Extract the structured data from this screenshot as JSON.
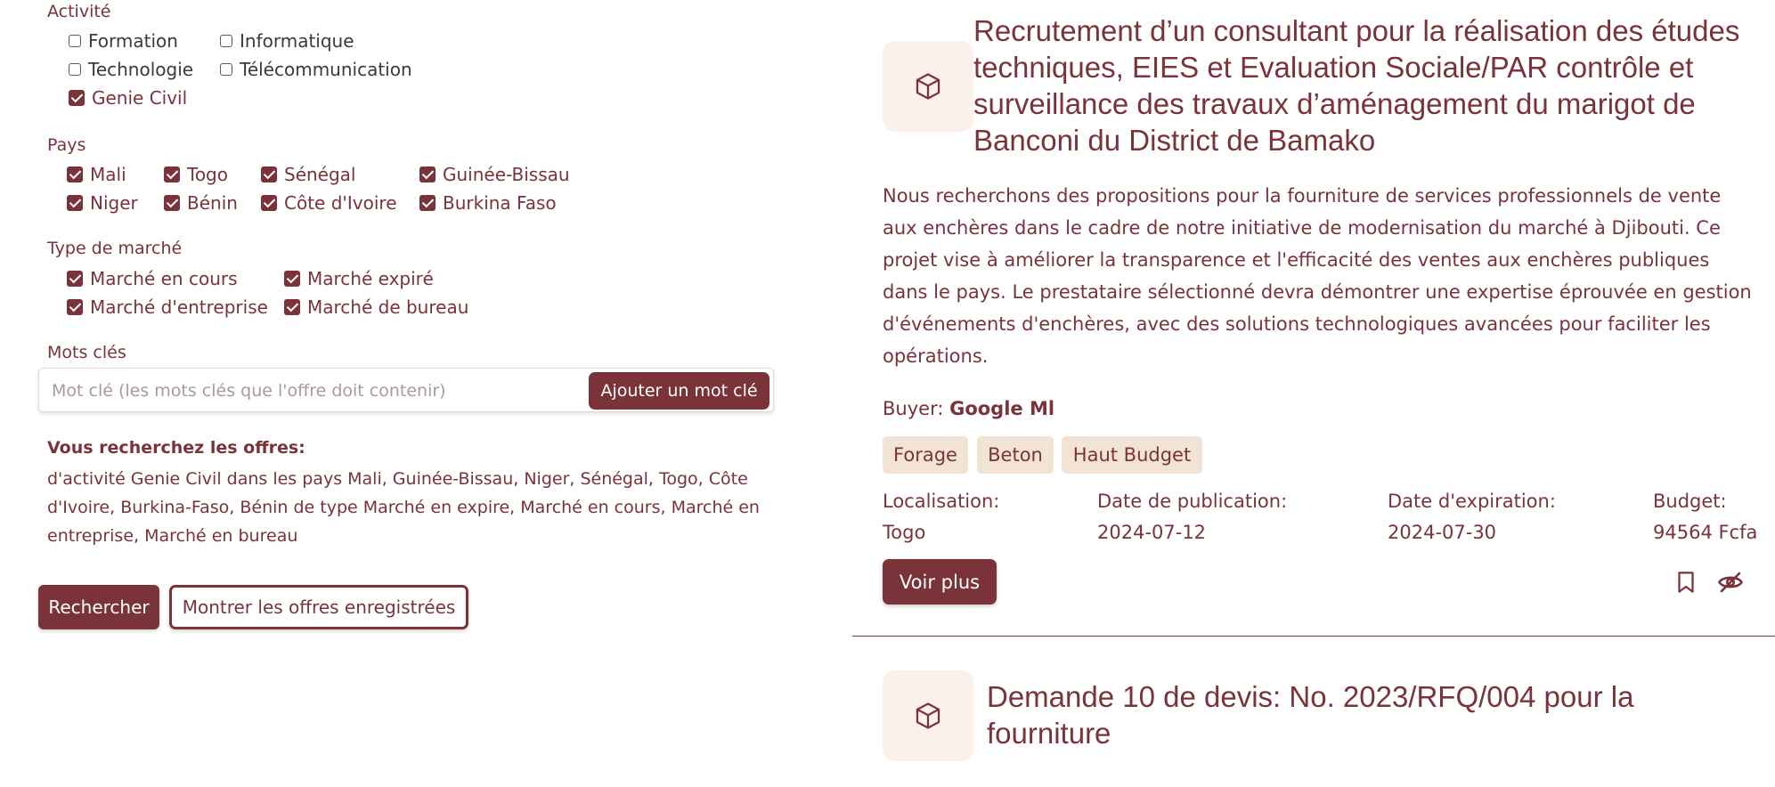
{
  "filters": {
    "activity": {
      "label": "Activité",
      "options": [
        {
          "label": "Formation",
          "checked": false
        },
        {
          "label": "Informatique",
          "checked": false
        },
        {
          "label": "Technologie",
          "checked": false
        },
        {
          "label": "Télécommunication",
          "checked": false
        },
        {
          "label": "Genie Civil",
          "checked": true
        }
      ]
    },
    "country": {
      "label": "Pays",
      "options": [
        {
          "label": "Mali",
          "checked": true
        },
        {
          "label": "Togo",
          "checked": true
        },
        {
          "label": "Sénégal",
          "checked": true
        },
        {
          "label": "Guinée-Bissau",
          "checked": true
        },
        {
          "label": "Niger",
          "checked": true
        },
        {
          "label": "Bénin",
          "checked": true
        },
        {
          "label": "Côte d'Ivoire",
          "checked": true
        },
        {
          "label": "Burkina Faso",
          "checked": true
        }
      ]
    },
    "market_type": {
      "label": "Type de marché",
      "options": [
        {
          "label": "Marché en cours",
          "checked": true
        },
        {
          "label": "Marché expiré",
          "checked": true
        },
        {
          "label": "Marché d'entreprise",
          "checked": true
        },
        {
          "label": "Marché de bureau",
          "checked": true
        }
      ]
    },
    "keywords": {
      "label": "Mots clés",
      "value": "",
      "placeholder": "Mot clé (les mots clés que l'offre doit contenir)",
      "add_label": "Ajouter un mot clé"
    },
    "summary": {
      "title": "Vous recherchez les offres:",
      "text": "d'activité Genie Civil dans les pays Mali, Guinée-Bissau, Niger, Sénégal, Togo, Côte d'Ivoire, Burkina-Faso, Bénin de type Marché en expire, Marché en cours, Marché en entreprise, Marché en bureau"
    },
    "search_label": "Rechercher",
    "saved_label": "Montrer les offres enregistrées"
  },
  "offers": [
    {
      "icon": "cube-icon",
      "title": "Recrutement d’un consultant pour la réalisation des études techniques, EIES et Evaluation Sociale/PAR contrôle et surveillance des travaux d’aménagement du marigot de Banconi du District de Bamako",
      "description": "Nous recherchons des propositions pour la fourniture de services professionnels de vente aux enchères dans le cadre de notre initiative de modernisation du marché à Djibouti. Ce projet vise à améliorer la transparence et l'efficacité des ventes aux enchères publiques dans le pays. Le prestataire sélectionné devra démontrer une expertise éprouvée en gestion d'événements d'enchères, avec des solutions technologiques avancées pour faciliter les opérations.",
      "buyer_label": "Buyer:",
      "buyer": "Google Ml",
      "tags": [
        "Forage",
        "Beton",
        "Haut Budget"
      ],
      "meta": {
        "location_label": "Localisation:",
        "location": "Togo",
        "publication_label": "Date de publication:",
        "publication": "2024-07-12",
        "expiration_label": "Date d'expiration:",
        "expiration": "2024-07-30",
        "budget_label": "Budget:",
        "budget": "94564 Fcfa"
      },
      "more_label": "Voir plus",
      "actions": [
        "bookmark-icon",
        "eye-slash-icon"
      ]
    },
    {
      "icon": "cube-icon",
      "title": "Demande 10 de devis: No. 2023/RFQ/004 pour la fourniture"
    }
  ],
  "colors": {
    "accent": "#7a3339",
    "tag_bg": "#f3e3d4",
    "icon_bg": "#fbf1ea"
  }
}
